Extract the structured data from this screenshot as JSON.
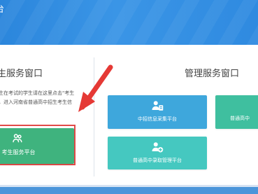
{
  "header": {
    "title": "台"
  },
  "student": {
    "heading": "生服务窗口",
    "note_lines": [
      "生在考试的学生请在这里点击\"考生",
      "，进入河南省普通高中招生考生信"
    ],
    "button_label": "考生服务平台"
  },
  "admin": {
    "heading": "管理服务窗口",
    "cards": [
      {
        "label": "中招信息采集平台",
        "icon": "user-doc-icon",
        "color": "#3ea7dc"
      },
      {
        "label": "普通高中",
        "icon": "none",
        "color": "#3fbf9f"
      },
      {
        "label": "普通高中录取管理平台",
        "icon": "user-add-icon",
        "color": "#45c8c0"
      }
    ]
  },
  "colors": {
    "header_blue": "#2f8ae0",
    "student_green": "#3fb37e",
    "admin_blue": "#3ea7dc",
    "admin_green": "#3fbf9f",
    "admin_teal": "#45c8c0",
    "highlight_red": "#e14a48",
    "arrow_red": "#e53935"
  }
}
